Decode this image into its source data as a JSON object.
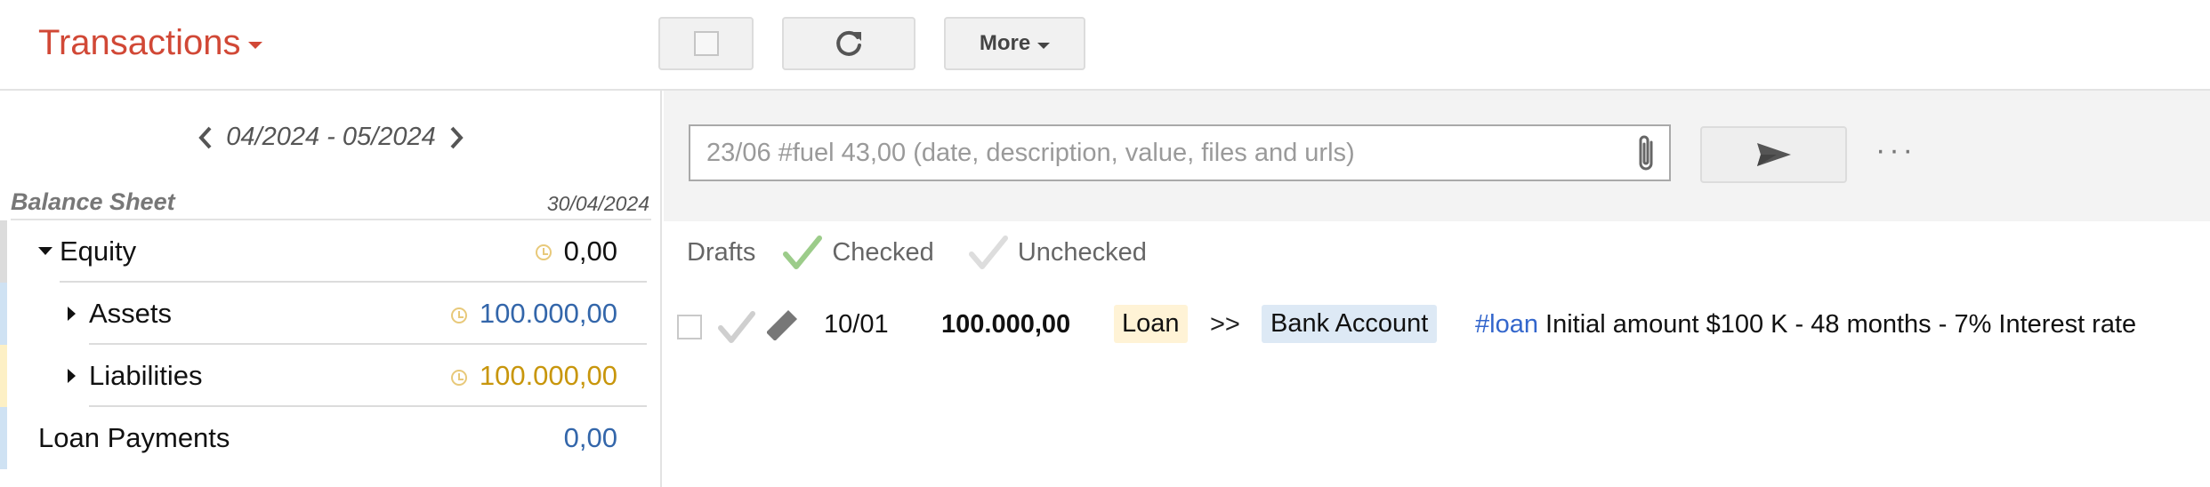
{
  "header": {
    "app_title": "Transactions",
    "more_label": "More"
  },
  "sidebar": {
    "period": "04/2024 - 05/2024",
    "balance_sheet_title": "Balance Sheet",
    "balance_sheet_date": "30/04/2024",
    "accounts": [
      {
        "name": "Equity",
        "value": "0,00",
        "value_color": "#111111",
        "stripe_color": "#dcdcdc",
        "expanded": true
      },
      {
        "name": "Assets",
        "value": "100.000,00",
        "value_color": "#3366aa",
        "stripe_color": "#cfe2f3",
        "expanded": false
      },
      {
        "name": "Liabilities",
        "value": "100.000,00",
        "value_color": "#c8960c",
        "stripe_color": "#fdf0c5",
        "expanded": false
      },
      {
        "name": "Loan Payments",
        "value": "0,00",
        "value_color": "#3366aa",
        "stripe_color": "#cfe2f3"
      }
    ]
  },
  "composer": {
    "placeholder": "23/06 #fuel 43,00 (date, description, value, files and urls)"
  },
  "filters": {
    "drafts": "Drafts",
    "checked": "Checked",
    "unchecked": "Unchecked"
  },
  "transactions": [
    {
      "date": "10/01",
      "amount": "100.000,00",
      "from": "Loan",
      "separator": ">>",
      "to": "Bank Account",
      "hashtag": "#loan",
      "description": " Initial amount $100 K - 48 months - 7% Interest rate"
    }
  ],
  "colors": {
    "accent": "#d14836",
    "checked_green": "#9ccc8a",
    "unchecked_gray": "#dddddd",
    "link_blue": "#3366cc"
  }
}
